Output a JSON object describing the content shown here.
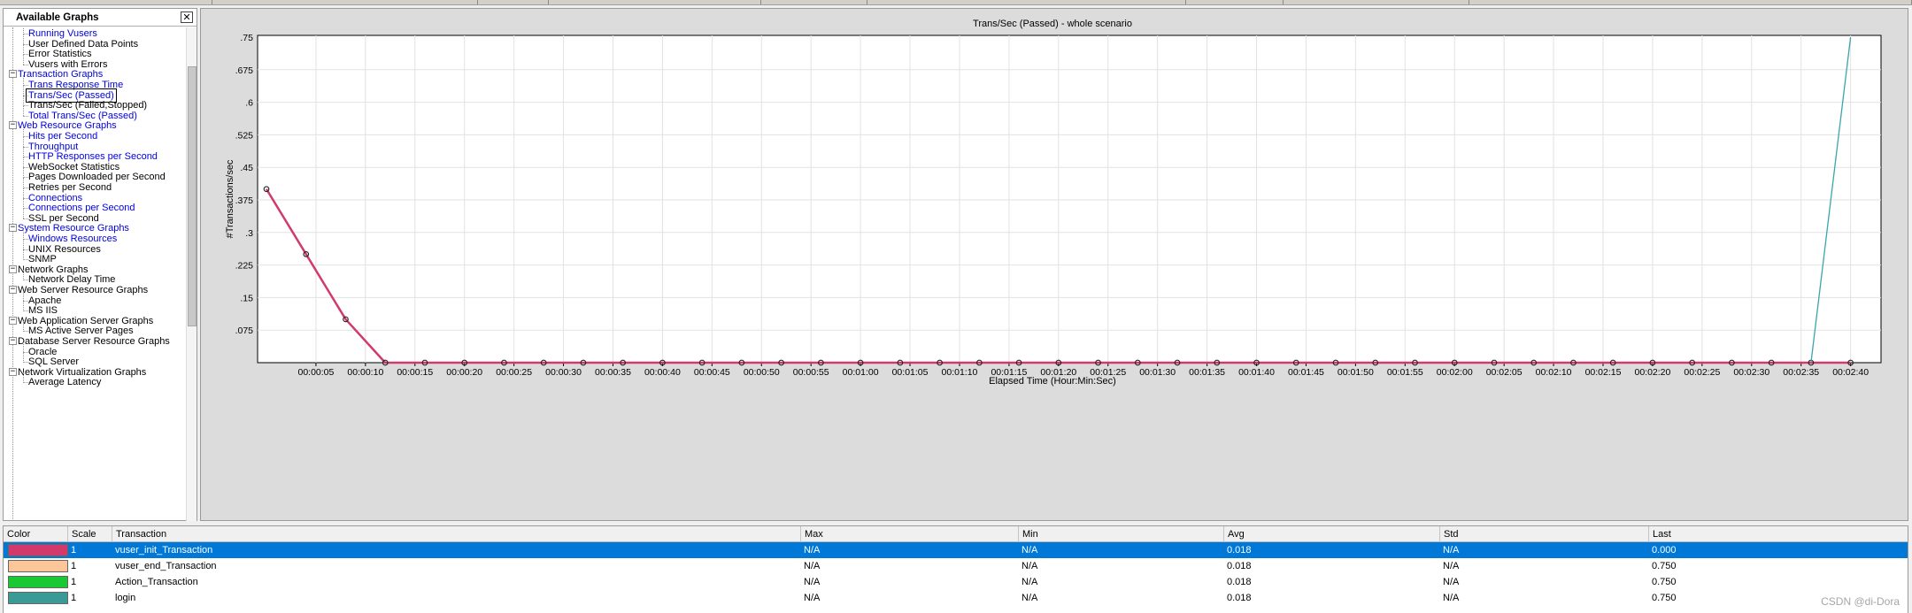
{
  "panel": {
    "title": "Available Graphs",
    "close_label": "✕",
    "tree": [
      {
        "label": "Running Vusers",
        "level": 1,
        "link": true
      },
      {
        "label": "User Defined Data Points",
        "level": 1,
        "link": false
      },
      {
        "label": "Error Statistics",
        "level": 1,
        "link": false
      },
      {
        "label": "Vusers with Errors",
        "level": 1,
        "link": false
      },
      {
        "label": "Transaction Graphs",
        "level": 0,
        "link": true
      },
      {
        "label": "Trans Response Time",
        "level": 1,
        "link": true
      },
      {
        "label": "Trans/Sec (Passed)",
        "level": 1,
        "link": true,
        "selected": true
      },
      {
        "label": "Trans/Sec (Failed,Stopped)",
        "level": 1,
        "link": false
      },
      {
        "label": "Total Trans/Sec (Passed)",
        "level": 1,
        "link": true
      },
      {
        "label": "Web Resource Graphs",
        "level": 0,
        "link": true
      },
      {
        "label": "Hits per Second",
        "level": 1,
        "link": true
      },
      {
        "label": "Throughput",
        "level": 1,
        "link": true
      },
      {
        "label": "HTTP Responses per Second",
        "level": 1,
        "link": true
      },
      {
        "label": "WebSocket Statistics",
        "level": 1,
        "link": false
      },
      {
        "label": "Pages Downloaded per Second",
        "level": 1,
        "link": false
      },
      {
        "label": "Retries per Second",
        "level": 1,
        "link": false
      },
      {
        "label": "Connections",
        "level": 1,
        "link": true
      },
      {
        "label": "Connections per Second",
        "level": 1,
        "link": true
      },
      {
        "label": "SSL per Second",
        "level": 1,
        "link": false
      },
      {
        "label": "System Resource Graphs",
        "level": 0,
        "link": true
      },
      {
        "label": "Windows Resources",
        "level": 1,
        "link": true
      },
      {
        "label": "UNIX Resources",
        "level": 1,
        "link": false
      },
      {
        "label": "SNMP",
        "level": 1,
        "link": false
      },
      {
        "label": "Network Graphs",
        "level": 0,
        "link": false
      },
      {
        "label": "Network Delay Time",
        "level": 1,
        "link": false
      },
      {
        "label": "Web Server Resource Graphs",
        "level": 0,
        "link": false
      },
      {
        "label": "Apache",
        "level": 1,
        "link": false
      },
      {
        "label": "MS IIS",
        "level": 1,
        "link": false
      },
      {
        "label": "Web Application Server Graphs",
        "level": 0,
        "link": false
      },
      {
        "label": "MS Active Server Pages",
        "level": 1,
        "link": false
      },
      {
        "label": "Database Server Resource Graphs",
        "level": 0,
        "link": false
      },
      {
        "label": "Oracle",
        "level": 1,
        "link": false
      },
      {
        "label": "SQL Server",
        "level": 1,
        "link": false
      },
      {
        "label": "Network Virtualization Graphs",
        "level": 0,
        "link": false
      },
      {
        "label": "Average Latency",
        "level": 1,
        "link": false
      }
    ]
  },
  "chart_data": {
    "type": "line",
    "title": "Trans/Sec (Passed) - whole scenario",
    "xlabel": "Elapsed Time (Hour:Min:Sec)",
    "ylabel": "#Transactions/sec",
    "xlim": [
      0,
      162
    ],
    "ylim": [
      0,
      0.75
    ],
    "yticks": [
      ".075",
      ".15",
      ".225",
      ".3",
      ".375",
      ".45",
      ".525",
      ".6",
      ".675",
      ".75"
    ],
    "xticks": [
      "00:00:05",
      "00:00:10",
      "00:00:15",
      "00:00:20",
      "00:00:25",
      "00:00:30",
      "00:00:35",
      "00:00:40",
      "00:00:45",
      "00:00:50",
      "00:00:55",
      "00:01:00",
      "00:01:05",
      "00:01:10",
      "00:01:15",
      "00:01:20",
      "00:01:25",
      "00:01:30",
      "00:01:35",
      "00:01:40",
      "00:01:45",
      "00:01:50",
      "00:01:55",
      "00:02:00",
      "00:02:05",
      "00:02:10",
      "00:02:15",
      "00:02:20",
      "00:02:25",
      "00:02:30",
      "00:02:35",
      "00:02:40"
    ],
    "grid": true,
    "series": [
      {
        "name": "vuser_init_Transaction",
        "color": "#d13a6a",
        "markers": true,
        "x": [
          0,
          4,
          8,
          12,
          16,
          20,
          24,
          28,
          32,
          36,
          40,
          44,
          48,
          52,
          56,
          60,
          64,
          68,
          72,
          76,
          80,
          84,
          88,
          92,
          96,
          100,
          104,
          108,
          112,
          116,
          120,
          124,
          128,
          132,
          136,
          140,
          144,
          148,
          152,
          156,
          160
        ],
        "y": [
          0.4,
          0.25,
          0.1,
          0,
          0,
          0,
          0,
          0,
          0,
          0,
          0,
          0,
          0,
          0,
          0,
          0,
          0,
          0,
          0,
          0,
          0,
          0,
          0,
          0,
          0,
          0,
          0,
          0,
          0,
          0,
          0,
          0,
          0,
          0,
          0,
          0,
          0,
          0,
          0,
          0,
          0
        ]
      },
      {
        "name": "login",
        "color": "#3aa5ac",
        "markers": false,
        "x": [
          156,
          160
        ],
        "y": [
          0,
          0.75
        ]
      }
    ]
  },
  "legend": {
    "headers": [
      "Color",
      "Scale",
      "Transaction",
      "Max",
      "Min",
      "Avg",
      "Std",
      "Last"
    ],
    "rows": [
      {
        "color": "#d13a6a",
        "scale": "1",
        "transaction": "vuser_init_Transaction",
        "max": "N/A",
        "min": "N/A",
        "avg": "0.018",
        "std": "N/A",
        "last": "0.000",
        "selected": true
      },
      {
        "color": "#fcc59a",
        "scale": "1",
        "transaction": "vuser_end_Transaction",
        "max": "N/A",
        "min": "N/A",
        "avg": "0.018",
        "std": "N/A",
        "last": "0.750"
      },
      {
        "color": "#19c832",
        "scale": "1",
        "transaction": "Action_Transaction",
        "max": "N/A",
        "min": "N/A",
        "avg": "0.018",
        "std": "N/A",
        "last": "0.750"
      },
      {
        "color": "#3a9a96",
        "scale": "1",
        "transaction": "login",
        "max": "N/A",
        "min": "N/A",
        "avg": "0.018",
        "std": "N/A",
        "last": "0.750"
      }
    ]
  },
  "watermark": "CSDN @di-Dora"
}
